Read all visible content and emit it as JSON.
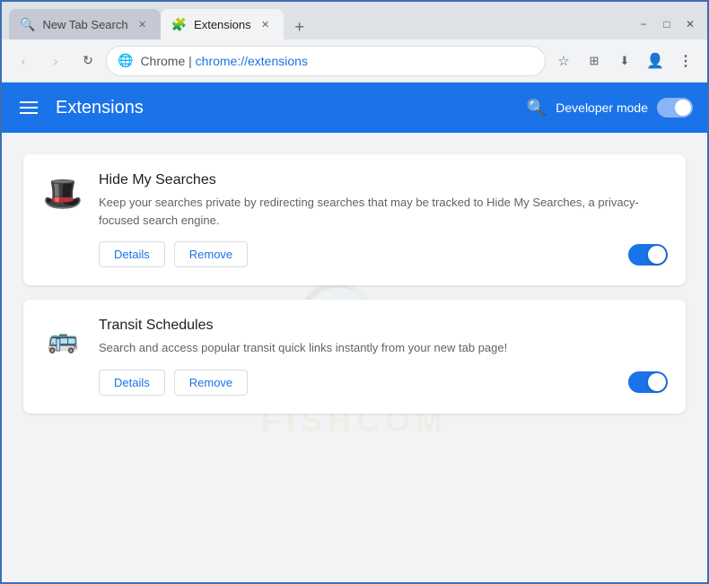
{
  "browser": {
    "tabs": [
      {
        "id": "tab-1",
        "label": "New Tab Search",
        "icon": "🔍",
        "active": false,
        "closable": true
      },
      {
        "id": "tab-2",
        "label": "Extensions",
        "icon": "🧩",
        "active": true,
        "closable": true
      }
    ],
    "new_tab_label": "+",
    "window_controls": {
      "minimize": "−",
      "maximize": "□",
      "close": "✕"
    },
    "nav": {
      "back_label": "‹",
      "forward_label": "›",
      "reload_label": "↻",
      "address_domain": "Chrome  |  ",
      "address_path": "chrome://extensions",
      "bookmark_label": "☆",
      "extensions_label": "⊞",
      "downloads_label": "↓",
      "profile_label": "👤",
      "menu_label": "⋮"
    }
  },
  "extensions_page": {
    "header": {
      "hamburger_label": "☰",
      "title": "Extensions",
      "search_label": "🔍",
      "dev_mode_label": "Developer mode"
    },
    "extensions": [
      {
        "id": "ext-1",
        "name": "Hide My Searches",
        "description": "Keep your searches private by redirecting searches that may be tracked to Hide My Searches, a privacy-focused search engine.",
        "icon": "🎩",
        "enabled": true,
        "details_label": "Details",
        "remove_label": "Remove"
      },
      {
        "id": "ext-2",
        "name": "Transit Schedules",
        "description": "Search and access popular transit quick links instantly from your new tab page!",
        "icon": "🚌",
        "enabled": true,
        "details_label": "Details",
        "remove_label": "Remove"
      }
    ]
  },
  "watermark": {
    "text": "FISHCOM"
  }
}
